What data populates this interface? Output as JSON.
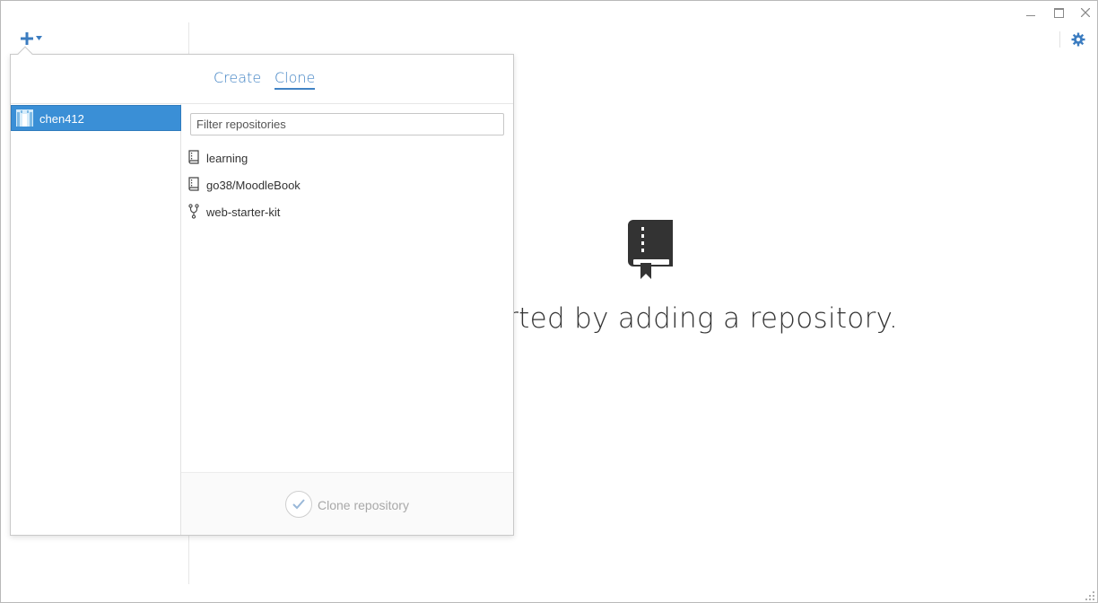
{
  "window": {
    "controls": [
      "minimize-icon",
      "maximize-icon",
      "close-icon"
    ]
  },
  "toolbar": {
    "add_icon": "plus-icon",
    "dropdown_icon": "caret-down-icon",
    "settings_icon": "gear-icon"
  },
  "welcome": {
    "icon": "repository-book-icon",
    "text": "arted by adding a repository."
  },
  "popover": {
    "tabs": [
      {
        "label": "Create",
        "active": false
      },
      {
        "label": "Clone",
        "active": true
      }
    ],
    "accounts": [
      {
        "name": "chen412",
        "selected": true
      }
    ],
    "filter": {
      "placeholder": "Filter repositories",
      "value": ""
    },
    "repositories": [
      {
        "name": "learning",
        "icon": "repo-icon"
      },
      {
        "name": "go38/MoodleBook",
        "icon": "repo-icon"
      },
      {
        "name": "web-starter-kit",
        "icon": "fork-icon"
      }
    ],
    "clone_button": {
      "label": "Clone repository",
      "icon": "check-icon"
    }
  },
  "colors": {
    "accent": "#4183c4",
    "selected_account": "#3a8fd6"
  }
}
